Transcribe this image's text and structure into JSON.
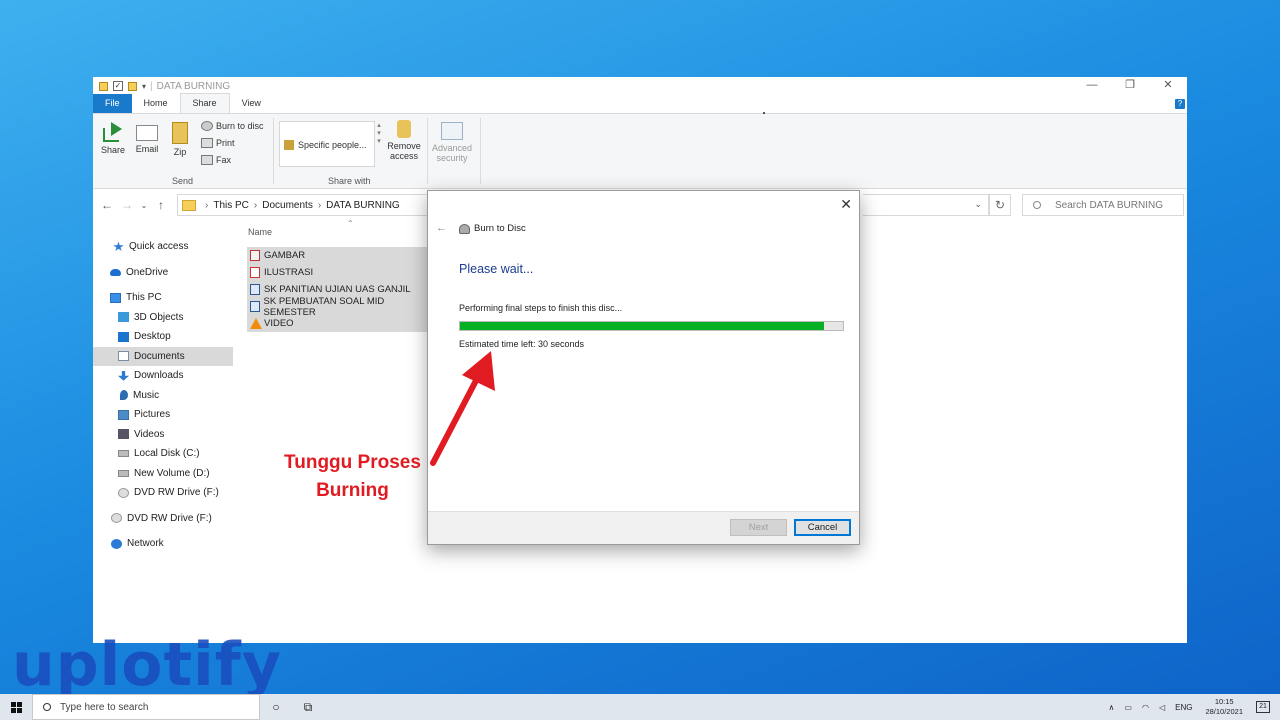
{
  "window": {
    "title": "DATA BURNING",
    "controls": {
      "minimize": "—",
      "restore": "❐",
      "close": "✕"
    }
  },
  "ribbon": {
    "tabs": [
      {
        "label": "File"
      },
      {
        "label": "Home"
      },
      {
        "label": "Share"
      },
      {
        "label": "View"
      }
    ],
    "send": {
      "share": "Share",
      "email": "Email",
      "zip": "Zip",
      "burn": "Burn to disc",
      "print": "Print",
      "fax": "Fax",
      "group_label": "Send"
    },
    "share_with": {
      "list_item": "Specific people...",
      "remove_access": "Remove access",
      "advanced_security": "Advanced security",
      "group_label": "Share with"
    }
  },
  "address": {
    "crumbs": [
      "This PC",
      "Documents",
      "DATA BURNING"
    ],
    "search_placeholder": "Search DATA BURNING"
  },
  "sidebar": {
    "items": [
      {
        "label": "Quick access",
        "icon": "star-icon"
      },
      {
        "label": "OneDrive",
        "icon": "cloud-icon"
      },
      {
        "label": "This PC",
        "icon": "computer-icon"
      },
      {
        "label": "3D Objects",
        "icon": "cube-icon"
      },
      {
        "label": "Desktop",
        "icon": "desktop-icon"
      },
      {
        "label": "Documents",
        "icon": "documents-icon"
      },
      {
        "label": "Downloads",
        "icon": "download-icon"
      },
      {
        "label": "Music",
        "icon": "music-icon"
      },
      {
        "label": "Pictures",
        "icon": "pictures-icon"
      },
      {
        "label": "Videos",
        "icon": "videos-icon"
      },
      {
        "label": "Local Disk (C:)",
        "icon": "drive-icon"
      },
      {
        "label": "New Volume (D:)",
        "icon": "drive-icon"
      },
      {
        "label": "DVD RW Drive (F:)",
        "icon": "dvd-icon"
      },
      {
        "label": "DVD RW Drive (F:)",
        "icon": "dvd-icon"
      },
      {
        "label": "Network",
        "icon": "network-icon"
      }
    ]
  },
  "files": {
    "column_name": "Name",
    "rows": [
      {
        "name": "GAMBAR",
        "icon": "image-file-icon"
      },
      {
        "name": "ILUSTRASI",
        "icon": "pdf-file-icon"
      },
      {
        "name": "SK PANITIAN UJIAN UAS GANJIL",
        "icon": "word-file-icon"
      },
      {
        "name": "SK PEMBUATAN SOAL MID SEMESTER",
        "icon": "word-file-icon"
      },
      {
        "name": "VIDEO",
        "icon": "vlc-file-icon"
      }
    ]
  },
  "dialog": {
    "title": "Burn to Disc",
    "heading": "Please wait...",
    "status": "Performing final steps to finish this disc...",
    "progress": 0.95,
    "eta": "Estimated time left: 30 seconds",
    "next_label": "Next",
    "cancel_label": "Cancel"
  },
  "annotation": {
    "line1": "Tunggu Proses",
    "line2": "Burning",
    "color": "#e11b22"
  },
  "watermark": {
    "text": "uplotify"
  },
  "taskbar": {
    "search_placeholder": "Type here to search",
    "lang": "ENG",
    "time": "10:15",
    "date": "28/10/2021",
    "notifications": "21"
  },
  "colors": {
    "accent": "#1979ca",
    "progress": "#06b025"
  }
}
